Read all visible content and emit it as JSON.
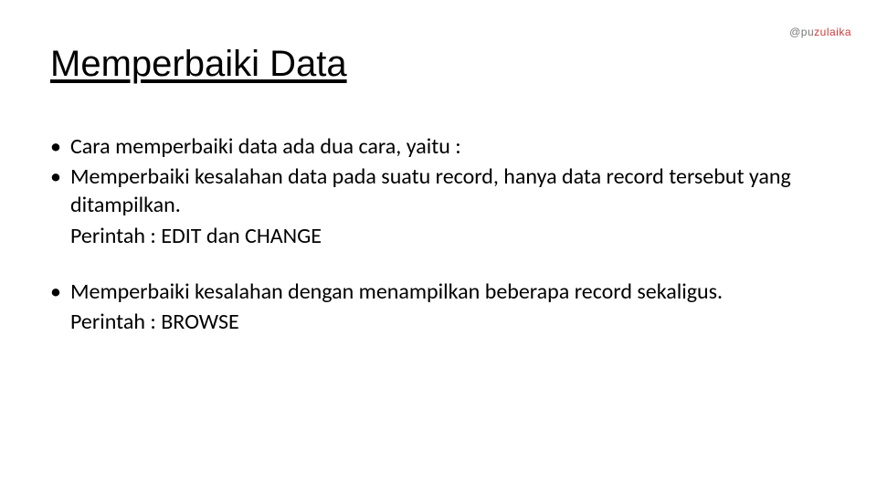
{
  "title": "Memperbaiki Data",
  "watermark": {
    "prefix": "@pu",
    "name": "zulaika"
  },
  "bullets": [
    "Cara memperbaiki data ada dua cara, yaitu :",
    "Memperbaiki kesalahan data pada suatu record, hanya data record tersebut yang ditampilkan.",
    "Perintah : EDIT dan CHANGE",
    "Memperbaiki kesalahan dengan menampilkan beberapa record sekaligus.",
    "Perintah : BROWSE"
  ]
}
